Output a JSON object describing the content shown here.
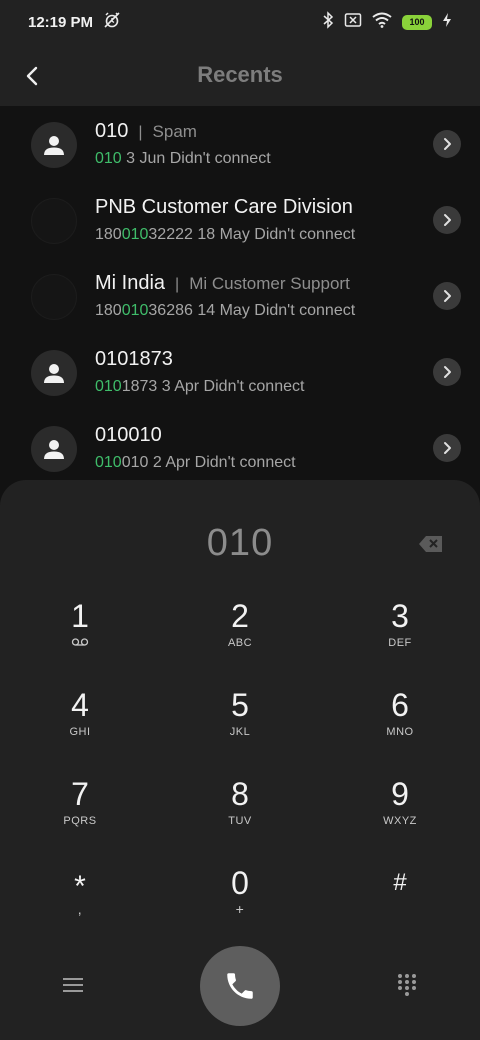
{
  "status": {
    "time": "12:19 PM",
    "battery": "100",
    "icons": [
      "alarm-off-icon",
      "bluetooth-icon",
      "sim-off-icon",
      "wifi-icon",
      "battery-icon",
      "charging-icon"
    ]
  },
  "app_bar": {
    "title": "Recents"
  },
  "recents": [
    {
      "name": "010",
      "tag": "Spam",
      "num_pre": "",
      "num_hl": "010",
      "num_post": "",
      "detail": "3 Jun Didn't connect",
      "avatar": "person"
    },
    {
      "name": "PNB Customer Care Division",
      "tag": "",
      "num_pre": "180",
      "num_hl": "010",
      "num_post": "32222",
      "detail": "18 May Didn't connect",
      "avatar": "empty"
    },
    {
      "name": "Mi India",
      "tag": "Mi Customer Support",
      "num_pre": "180",
      "num_hl": "010",
      "num_post": "36286",
      "detail": "14 May Didn't connect",
      "avatar": "empty"
    },
    {
      "name": "0101873",
      "tag": "",
      "num_pre": "",
      "num_hl": "010",
      "num_post": "1873",
      "detail": "3 Apr Didn't connect",
      "avatar": "person"
    },
    {
      "name": "010010",
      "tag": "",
      "num_pre": "",
      "num_hl": "010",
      "num_post": "010",
      "detail": "2 Apr Didn't connect",
      "avatar": "person"
    }
  ],
  "dialer": {
    "input": "010",
    "keys": [
      {
        "digit": "1",
        "letters": ""
      },
      {
        "digit": "2",
        "letters": "ABC"
      },
      {
        "digit": "3",
        "letters": "DEF"
      },
      {
        "digit": "4",
        "letters": "GHI"
      },
      {
        "digit": "5",
        "letters": "JKL"
      },
      {
        "digit": "6",
        "letters": "MNO"
      },
      {
        "digit": "7",
        "letters": "PQRS"
      },
      {
        "digit": "8",
        "letters": "TUV"
      },
      {
        "digit": "9",
        "letters": "WXYZ"
      },
      {
        "digit": "*",
        "letters": ","
      },
      {
        "digit": "0",
        "letters": "+"
      },
      {
        "digit": "#",
        "letters": ""
      }
    ]
  },
  "colors": {
    "highlight": "#3fbd6a",
    "background": "#121212",
    "panel": "#222222",
    "call_button": "#5e5e5e",
    "battery": "#8ad23a"
  }
}
